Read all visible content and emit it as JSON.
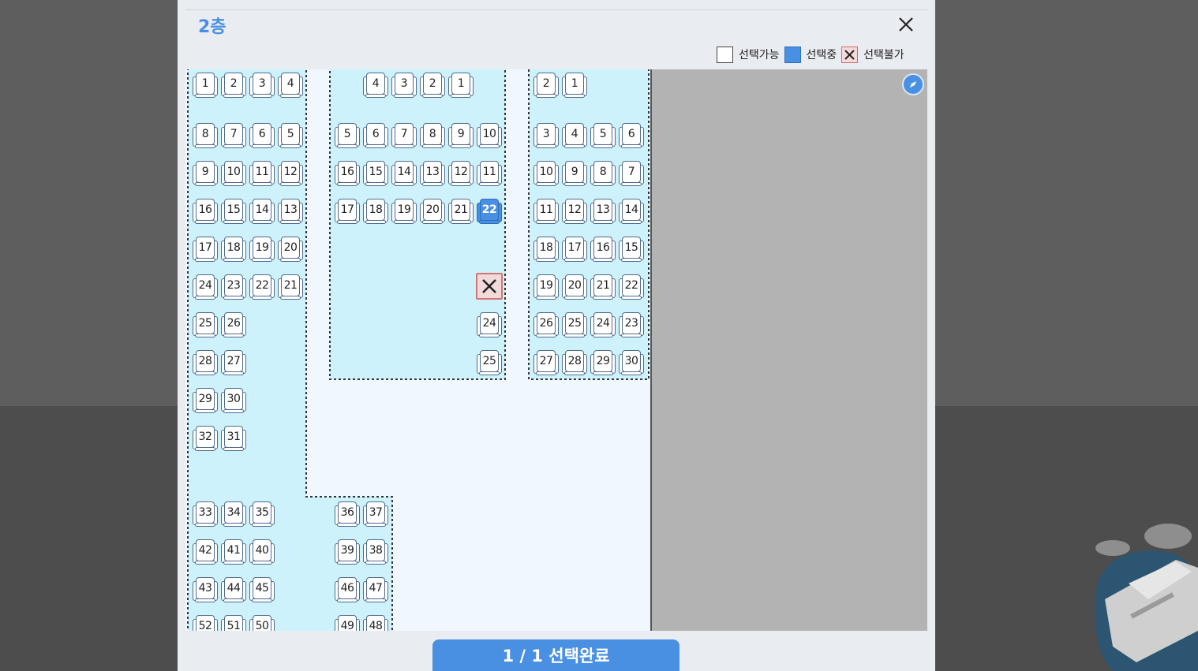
{
  "header": {
    "floor_title": "2층",
    "remnant_parts": [
      "",
      "",
      "",
      ""
    ],
    "close_icon": "close-icon"
  },
  "legend": [
    {
      "key": "available",
      "label": "선택가능",
      "color": "#ffffff"
    },
    {
      "key": "selected",
      "label": "선택중",
      "color": "#4a90e2"
    },
    {
      "key": "unavailable",
      "label": "선택불가",
      "color": "#f3dada"
    }
  ],
  "colors": {
    "accent": "#4a90e2",
    "zone": "#cdf2fb",
    "unavailable_border": "#d77272"
  },
  "confirm_button": {
    "label": "1 / 1 선택완료"
  },
  "compass_icon": "compass-icon",
  "seat_blocks": [
    {
      "name": "left-block",
      "rows": [
        [
          "1",
          "2",
          "3",
          "4"
        ],
        [
          "8",
          "7",
          "6",
          "5"
        ],
        [
          "9",
          "10",
          "11",
          "12"
        ],
        [
          "16",
          "15",
          "14",
          "13"
        ],
        [
          "17",
          "18",
          "19",
          "20"
        ],
        [
          "24",
          "23",
          "22",
          "21"
        ],
        [
          "25",
          "26"
        ],
        [
          "28",
          "27"
        ],
        [
          "29",
          "30"
        ],
        [
          "32",
          "31"
        ]
      ]
    },
    {
      "name": "left-lower-block",
      "rows": [
        [
          "33",
          "34",
          "35"
        ],
        [
          "42",
          "41",
          "40"
        ],
        [
          "43",
          "44",
          "45"
        ],
        [
          "52",
          "51",
          "50"
        ]
      ]
    },
    {
      "name": "center-lower-block",
      "rows": [
        [
          "36",
          "37"
        ],
        [
          "39",
          "38"
        ],
        [
          "46",
          "47"
        ],
        [
          "49",
          "48"
        ]
      ]
    },
    {
      "name": "center-block",
      "rows": [
        [
          "4",
          "3",
          "2",
          "1"
        ],
        [
          "5",
          "6",
          "7",
          "8",
          "9",
          "10"
        ],
        [
          "16",
          "15",
          "14",
          "13",
          "12",
          "11"
        ],
        [
          "17",
          "18",
          "19",
          "20",
          "21",
          "22"
        ],
        [
          "X"
        ],
        [
          "24"
        ],
        [
          "25"
        ]
      ]
    },
    {
      "name": "right-block",
      "rows": [
        [
          "2",
          "1"
        ],
        [
          "3",
          "4",
          "5",
          "6"
        ],
        [
          "10",
          "9",
          "8",
          "7"
        ],
        [
          "11",
          "12",
          "13",
          "14"
        ],
        [
          "18",
          "17",
          "16",
          "15"
        ],
        [
          "19",
          "20",
          "21",
          "22"
        ],
        [
          "26",
          "25",
          "24",
          "23"
        ],
        [
          "27",
          "28",
          "29",
          "30"
        ]
      ]
    }
  ],
  "selected_seat": {
    "block": "center-block",
    "number": "22"
  },
  "unavailable_seat": {
    "block": "center-block"
  }
}
